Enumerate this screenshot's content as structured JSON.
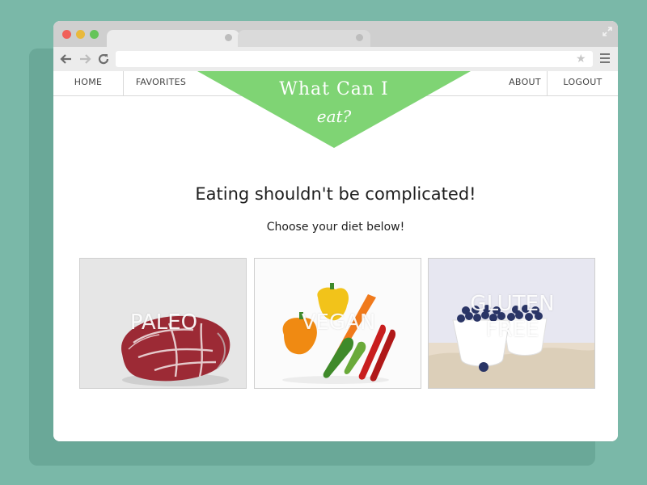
{
  "window": {
    "address_value": "",
    "address_placeholder": ""
  },
  "nav": {
    "home": "HOME",
    "favorites": "FAVORITES",
    "about": "ABOUT",
    "logout": "LOGOUT"
  },
  "logo": {
    "line1": "What Can I",
    "line2": "eat?"
  },
  "hero": {
    "headline": "Eating shouldn't be complicated!",
    "subheadline": "Choose your diet below!"
  },
  "diets": [
    {
      "label": "PALEO"
    },
    {
      "label": "VEGAN"
    },
    {
      "label_line1": "GLUTEN",
      "label_line2": "FREE"
    }
  ],
  "colors": {
    "background": "#7ab8a8",
    "logo_green": "#7fd474"
  },
  "icons": [
    "back-icon",
    "forward-icon",
    "reload-icon",
    "star-icon",
    "menu-icon",
    "expand-icon"
  ]
}
